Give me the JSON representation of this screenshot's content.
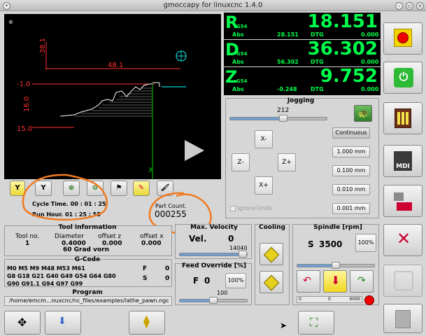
{
  "window": {
    "title": "gmoccapy for linuxcnc   1.4.0"
  },
  "preview": {
    "dims": [
      "-38.1",
      "48.1",
      "-1.0",
      "16.0",
      "15.0"
    ]
  },
  "toolbar": {
    "y_label1": "Y",
    "y_label2": "Y"
  },
  "info": {
    "cycle_time_label": "Cycle Time.",
    "cycle_time": "00 : 01 : 25",
    "run_hour_label": "Run Hour.",
    "run_hour": "01 : 25 : 55",
    "part_count_label": "Part Count.",
    "part_count": "000255"
  },
  "dro": {
    "r": {
      "letter": "R",
      "wcs": "G54",
      "value": "18.151",
      "abs_label": "Abs",
      "abs": "28.151",
      "dtg_label": "DTG",
      "dtg": "0.000"
    },
    "d": {
      "letter": "D",
      "wcs": "G54",
      "value": "36.302",
      "abs_label": "Abs",
      "abs": "56.302",
      "dtg_label": "DTG",
      "dtg": "0.000"
    },
    "z": {
      "letter": "Z",
      "wcs": "G54",
      "value": "9.752",
      "abs_label": "Abs",
      "abs": "-0.248",
      "dtg_label": "DTG",
      "dtg": "0.000"
    }
  },
  "jogging": {
    "title": "Jogging",
    "speed": "212",
    "speed_fraction": 0.55,
    "buttons": {
      "xminus": "X-",
      "zminus": "Z-",
      "zplus": "Z+",
      "xplus": "X+"
    },
    "ignore_limits": "Ignore limits",
    "increments": [
      "Continuous",
      "1.000 mm",
      "0.100 mm",
      "0.010 mm",
      "0.001 mm"
    ]
  },
  "tool_info": {
    "title": "Tool information",
    "headers": [
      "Tool no.",
      "Diameter",
      "offset z",
      "offset x"
    ],
    "values": [
      "1",
      "0.4000",
      "0.000",
      "0.000"
    ],
    "description": "60 Grad vorn"
  },
  "gcode": {
    "title": "G-Code",
    "lines": [
      "M0 M5 M9 M48 M53 M61",
      "G8 G18 G21 G40 G49 G54 G64 G80",
      "G90 G91.1 G94 G97 G99"
    ],
    "f_label": "F",
    "f_value": "0",
    "s_label": "S",
    "s_value": "0"
  },
  "program": {
    "title": "Program",
    "path": "/home/emcm...nuxcnc/nc_files/examples/lathe_pawn.ngc"
  },
  "max_velocity": {
    "title": "Max. Velocity",
    "label": "Vel.",
    "value": "0",
    "max": "14040",
    "fraction": 1.0
  },
  "feed_override": {
    "title": "Feed Override [%]",
    "label": "F",
    "value": "0",
    "reset": "100%",
    "slider_value": "100",
    "fraction": 0.5
  },
  "cooling": {
    "title": "Cooling"
  },
  "spindle": {
    "title": "Spindle [rpm]",
    "label": "S",
    "value": "3500",
    "reset": "100%",
    "bar_values": [
      "0",
      "0",
      "6000"
    ],
    "fraction": 0.5
  }
}
